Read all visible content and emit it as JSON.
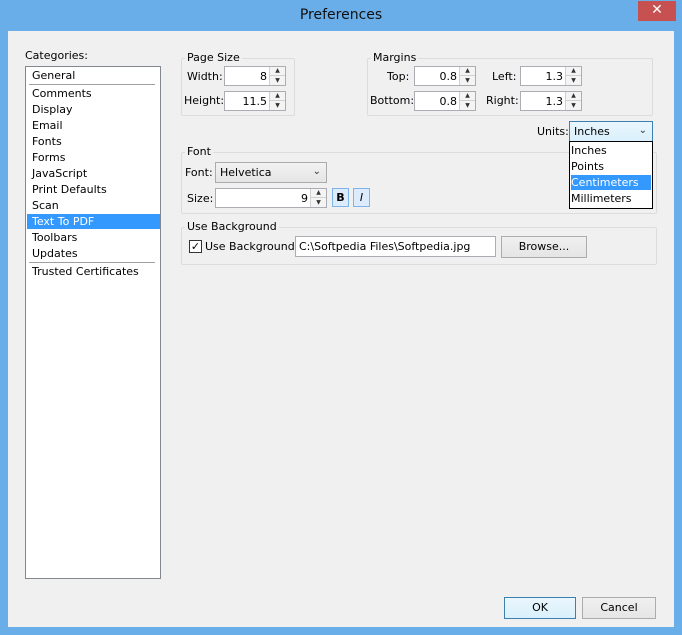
{
  "window": {
    "title": "Preferences",
    "close_glyph": "✕"
  },
  "categories": {
    "label": "Categories:",
    "items": [
      {
        "label": "General"
      },
      {
        "label": "Comments"
      },
      {
        "label": "Display"
      },
      {
        "label": "Email"
      },
      {
        "label": "Fonts"
      },
      {
        "label": "Forms"
      },
      {
        "label": "JavaScript"
      },
      {
        "label": "Print Defaults"
      },
      {
        "label": "Scan"
      },
      {
        "label": "Text To PDF"
      },
      {
        "label": "Toolbars"
      },
      {
        "label": "Updates"
      },
      {
        "label": "Trusted Certificates"
      }
    ],
    "selected": "Text To PDF"
  },
  "page_size": {
    "group_label": "Page Size",
    "width_label": "Width:",
    "width_value": "8",
    "height_label": "Height:",
    "height_value": "11.5"
  },
  "margins": {
    "group_label": "Margins",
    "top_label": "Top:",
    "top_value": "0.8",
    "bottom_label": "Bottom:",
    "bottom_value": "0.8",
    "left_label": "Left:",
    "left_value": "1.3",
    "right_label": "Right:",
    "right_value": "1.3"
  },
  "units": {
    "label": "Units:",
    "value": "Inches",
    "options": [
      "Inches",
      "Points",
      "Centimeters",
      "Millimeters"
    ],
    "highlighted": "Centimeters"
  },
  "font": {
    "group_label": "Font",
    "font_label": "Font:",
    "font_value": "Helvetica",
    "size_label": "Size:",
    "size_value": "9",
    "bold_label": "B",
    "italic_label": "I"
  },
  "background": {
    "group_label": "Use Background",
    "checkbox_label": "Use Background:",
    "checked": true,
    "check_glyph": "✓",
    "path_value": "C:\\Softpedia Files\\Softpedia.jpg",
    "browse_label": "Browse..."
  },
  "footer": {
    "ok_label": "OK",
    "cancel_label": "Cancel"
  },
  "icons": {
    "spin_up": "▲",
    "spin_down": "▼",
    "chevron": "⌄"
  }
}
